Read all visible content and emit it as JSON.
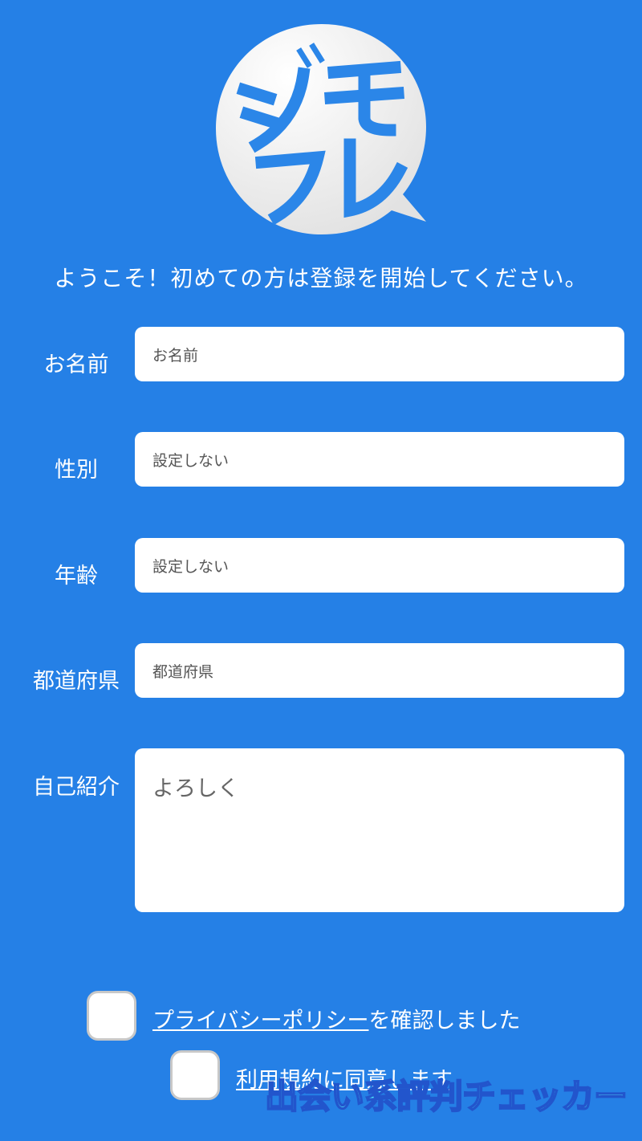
{
  "logo": {
    "alt_text": "ジモフレ"
  },
  "welcome_message": "ようこそ！初めての方は登録を開始してください。",
  "form": {
    "name": {
      "label": "お名前",
      "placeholder": "お名前"
    },
    "gender": {
      "label": "性別",
      "value": "設定しない"
    },
    "age": {
      "label": "年齢",
      "value": "設定しない"
    },
    "prefecture": {
      "label": "都道府県",
      "placeholder": "都道府県"
    },
    "bio": {
      "label": "自己紹介",
      "value": "よろしく"
    }
  },
  "agreements": {
    "privacy": {
      "link_text": "プライバシーポリシー",
      "suffix": "を確認しました"
    },
    "terms": {
      "link_text": "利用規約に同意します"
    }
  },
  "watermark": "出会い系評判チェッカー",
  "colors": {
    "background": "#2580e6",
    "field": "#ffffff",
    "logo_text": "#2b86e8",
    "watermark": "#52f0ff"
  }
}
